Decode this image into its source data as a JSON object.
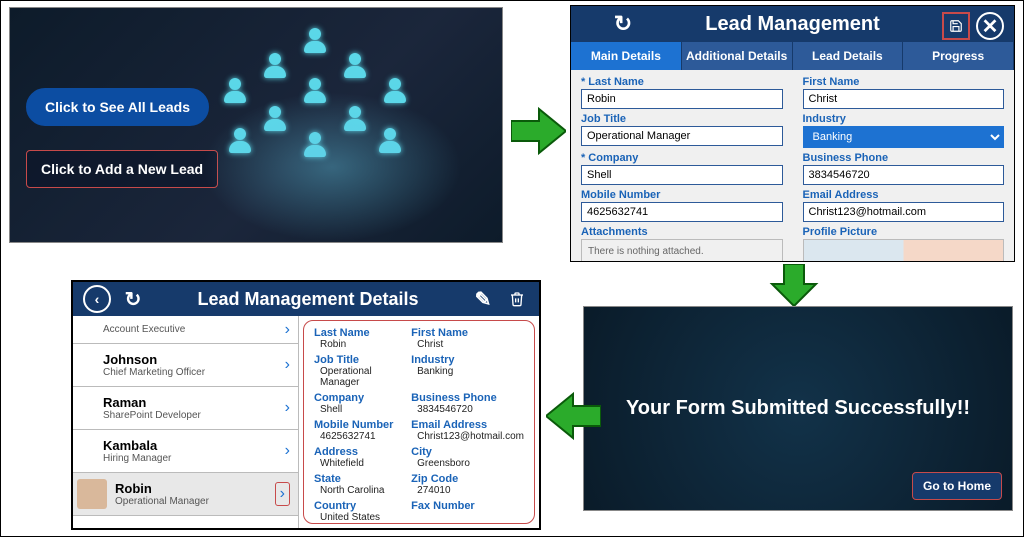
{
  "hero": {
    "see_all_label": "Click to See All Leads",
    "add_new_label": "Click to Add a New Lead"
  },
  "form": {
    "title": "Lead Management",
    "tabs": [
      "Main Details",
      "Additional Details",
      "Lead Details",
      "Progress"
    ],
    "fields": {
      "last_name": {
        "label": "Last Name",
        "value": "Robin"
      },
      "first_name": {
        "label": "First Name",
        "value": "Christ"
      },
      "job_title": {
        "label": "Job Title",
        "value": "Operational Manager"
      },
      "industry": {
        "label": "Industry",
        "value": "Banking"
      },
      "company": {
        "label": "Company",
        "value": "Shell"
      },
      "business_phone": {
        "label": "Business Phone",
        "value": "3834546720"
      },
      "mobile": {
        "label": "Mobile Number",
        "value": "4625632741"
      },
      "email": {
        "label": "Email Address",
        "value": "Christ123@hotmail.com"
      },
      "attachments": {
        "label": "Attachments",
        "empty": "There is nothing attached."
      },
      "profile": {
        "label": "Profile Picture"
      }
    }
  },
  "details": {
    "title": "Lead Management Details",
    "list": [
      {
        "name": "",
        "role": "Account Executive"
      },
      {
        "name": "Johnson",
        "role": "Chief Marketing Officer"
      },
      {
        "name": "Raman",
        "role": "SharePoint Developer"
      },
      {
        "name": "Kambala",
        "role": "Hiring Manager"
      },
      {
        "name": "Robin",
        "role": "Operational Manager",
        "selected": true
      }
    ],
    "record": {
      "last_name": {
        "k": "Last Name",
        "v": "Robin"
      },
      "first_name": {
        "k": "First Name",
        "v": "Christ"
      },
      "job_title": {
        "k": "Job Title",
        "v": "Operational Manager"
      },
      "industry": {
        "k": "Industry",
        "v": "Banking"
      },
      "company": {
        "k": "Company",
        "v": "Shell"
      },
      "business_phone": {
        "k": "Business Phone",
        "v": "3834546720"
      },
      "mobile": {
        "k": "Mobile Number",
        "v": "4625632741"
      },
      "email": {
        "k": "Email Address",
        "v": "Christ123@hotmail.com"
      },
      "address": {
        "k": "Address",
        "v": "Whitefield"
      },
      "city": {
        "k": "City",
        "v": "Greensboro"
      },
      "state": {
        "k": "State",
        "v": "North Carolina"
      },
      "zip": {
        "k": "Zip Code",
        "v": "274010"
      },
      "country": {
        "k": "Country",
        "v": "United States"
      },
      "fax": {
        "k": "Fax Number",
        "v": ""
      }
    }
  },
  "done": {
    "message": "Your Form Submitted Successfully!!",
    "home_label": "Go to Home"
  }
}
